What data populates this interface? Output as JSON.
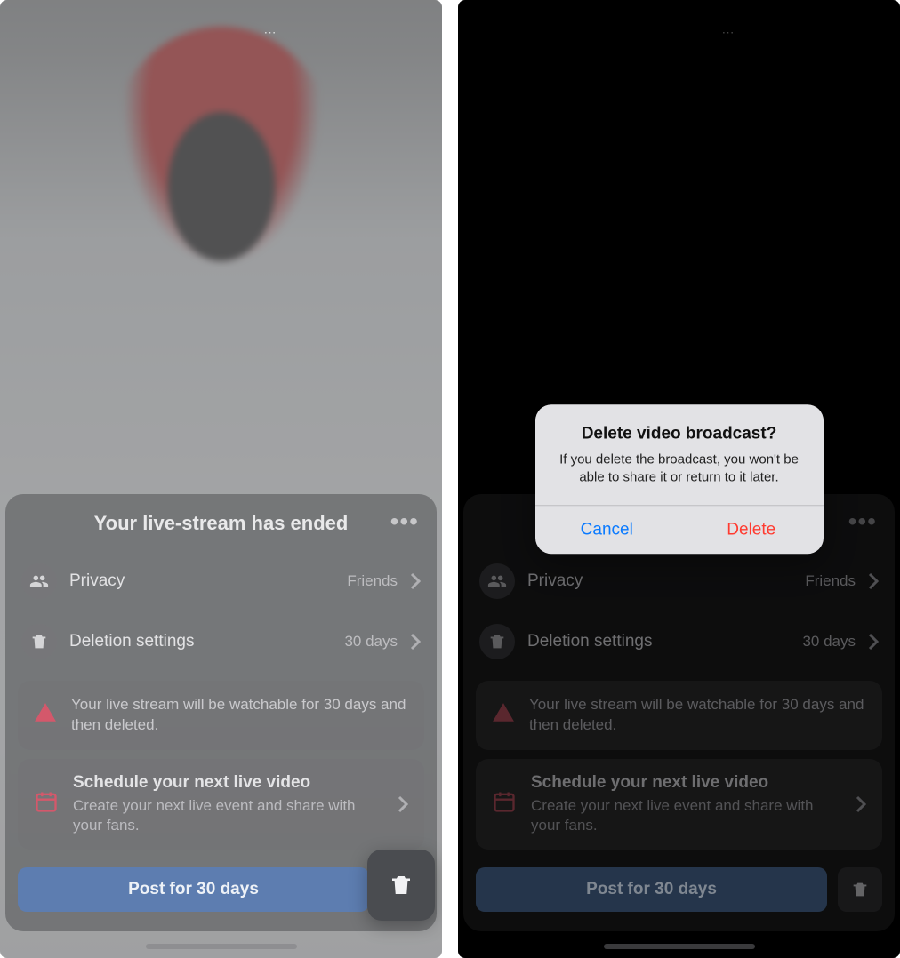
{
  "sheet": {
    "title": "Your live-stream has ended",
    "privacy_label": "Privacy",
    "privacy_value": "Friends",
    "deletion_label": "Deletion settings",
    "deletion_value": "30 days",
    "warn_text": "Your live stream will be watchable for 30 days and then deleted.",
    "schedule_title": "Schedule your next live video",
    "schedule_sub": "Create your next live event and share with your fans.",
    "post_btn": "Post for 30 days"
  },
  "alert": {
    "title": "Delete video broadcast?",
    "message": "If you delete the broadcast, you won't be able to share it or return to it later.",
    "cancel": "Cancel",
    "delete": "Delete"
  }
}
